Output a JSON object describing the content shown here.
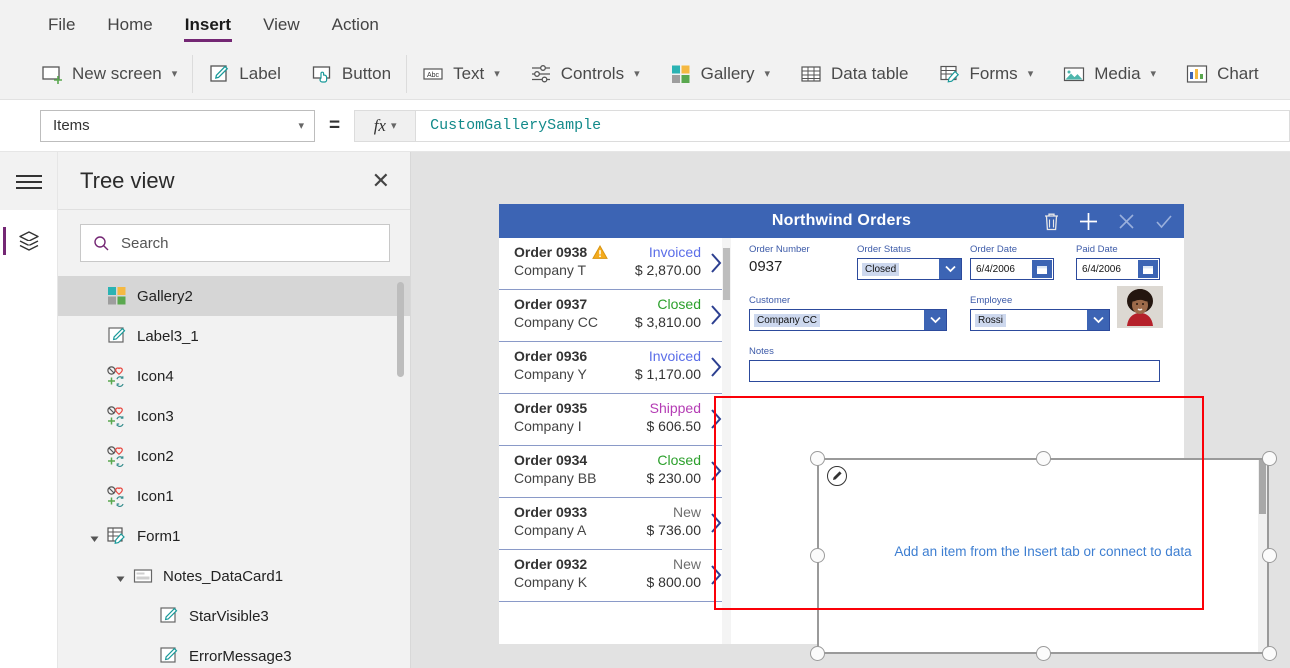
{
  "menu": {
    "tabs": [
      {
        "label": "File",
        "active": false
      },
      {
        "label": "Home",
        "active": false
      },
      {
        "label": "Insert",
        "active": true
      },
      {
        "label": "View",
        "active": false
      },
      {
        "label": "Action",
        "active": false
      }
    ]
  },
  "ribbon": {
    "items": [
      {
        "label": "New screen",
        "icon": "new-screen-icon",
        "caret": true
      },
      {
        "label": "Label",
        "icon": "label-icon",
        "caret": false
      },
      {
        "label": "Button",
        "icon": "button-icon",
        "caret": false
      },
      {
        "label": "Text",
        "icon": "text-icon",
        "caret": true
      },
      {
        "label": "Controls",
        "icon": "controls-icon",
        "caret": true
      },
      {
        "label": "Gallery",
        "icon": "gallery-icon",
        "caret": true
      },
      {
        "label": "Data table",
        "icon": "data-table-icon",
        "caret": false
      },
      {
        "label": "Forms",
        "icon": "forms-icon",
        "caret": true
      },
      {
        "label": "Media",
        "icon": "media-icon",
        "caret": true
      },
      {
        "label": "Chart",
        "icon": "chart-icon",
        "caret": false
      }
    ]
  },
  "formula_bar": {
    "property": "Items",
    "equals": "=",
    "fx_label": "fx",
    "formula": "CustomGallerySample"
  },
  "tree_view": {
    "title": "Tree view",
    "close_label": "✕",
    "search_placeholder": "Search",
    "items": [
      {
        "label": "Gallery2",
        "icon": "gallery-icon",
        "indent": 0,
        "selected": true,
        "arrow": ""
      },
      {
        "label": "Label3_1",
        "icon": "label-icon",
        "indent": 0,
        "selected": false,
        "arrow": ""
      },
      {
        "label": "Icon4",
        "icon": "icon-set-icon",
        "indent": 0,
        "selected": false,
        "arrow": ""
      },
      {
        "label": "Icon3",
        "icon": "icon-set-icon",
        "indent": 0,
        "selected": false,
        "arrow": ""
      },
      {
        "label": "Icon2",
        "icon": "icon-set-icon",
        "indent": 0,
        "selected": false,
        "arrow": ""
      },
      {
        "label": "Icon1",
        "icon": "icon-set-icon",
        "indent": 0,
        "selected": false,
        "arrow": ""
      },
      {
        "label": "Form1",
        "icon": "form-icon",
        "indent": 0,
        "selected": false,
        "arrow": "expanded"
      },
      {
        "label": "Notes_DataCard1",
        "icon": "datacard-icon",
        "indent": 1,
        "selected": false,
        "arrow": "expanded"
      },
      {
        "label": "StarVisible3",
        "icon": "label-icon",
        "indent": 2,
        "selected": false,
        "arrow": ""
      },
      {
        "label": "ErrorMessage3",
        "icon": "label-icon",
        "indent": 2,
        "selected": false,
        "arrow": ""
      }
    ]
  },
  "app_preview": {
    "appbar": {
      "title": "Northwind Orders",
      "icons": [
        {
          "name": "trash-icon",
          "enabled": true
        },
        {
          "name": "add-icon",
          "enabled": true
        },
        {
          "name": "cancel-icon",
          "enabled": false
        },
        {
          "name": "confirm-icon",
          "enabled": false
        }
      ]
    },
    "order_list": [
      {
        "order": "Order 0938",
        "company": "Company T",
        "status": "Invoiced",
        "status_color": "#5b6ee8",
        "amount": "$ 2,870.00",
        "warning": true
      },
      {
        "order": "Order 0937",
        "company": "Company CC",
        "status": "Closed",
        "status_color": "#2ca02c",
        "amount": "$ 3,810.00",
        "warning": false
      },
      {
        "order": "Order 0936",
        "company": "Company Y",
        "status": "Invoiced",
        "status_color": "#5b6ee8",
        "amount": "$ 1,170.00",
        "warning": false
      },
      {
        "order": "Order 0935",
        "company": "Company I",
        "status": "Shipped",
        "status_color": "#b43cb4",
        "amount": "$ 606.50",
        "warning": false
      },
      {
        "order": "Order 0934",
        "company": "Company BB",
        "status": "Closed",
        "status_color": "#2ca02c",
        "amount": "$ 230.00",
        "warning": false
      },
      {
        "order": "Order 0933",
        "company": "Company A",
        "status": "New",
        "status_color": "#6e6e6e",
        "amount": "$ 736.00",
        "warning": false
      },
      {
        "order": "Order 0932",
        "company": "Company K",
        "status": "New",
        "status_color": "#6e6e6e",
        "amount": "$ 800.00",
        "warning": false
      }
    ],
    "form": {
      "order_number_label": "Order Number",
      "order_number_value": "0937",
      "order_status_label": "Order Status",
      "order_status_value": "Closed",
      "order_date_label": "Order Date",
      "order_date_value": "6/4/2006",
      "paid_date_label": "Paid Date",
      "paid_date_value": "6/4/2006",
      "customer_label": "Customer",
      "customer_value": "Company CC",
      "employee_label": "Employee",
      "employee_value": "Rossi",
      "notes_label": "Notes",
      "notes_value": ""
    },
    "selection": {
      "placeholder_link1": "Add an item from the Insert tab",
      "placeholder_mid": " or ",
      "placeholder_link2": "connect to data",
      "edit_icon": "pencil-icon",
      "handle_count": 8,
      "annotation_color": "#fb0008"
    }
  }
}
